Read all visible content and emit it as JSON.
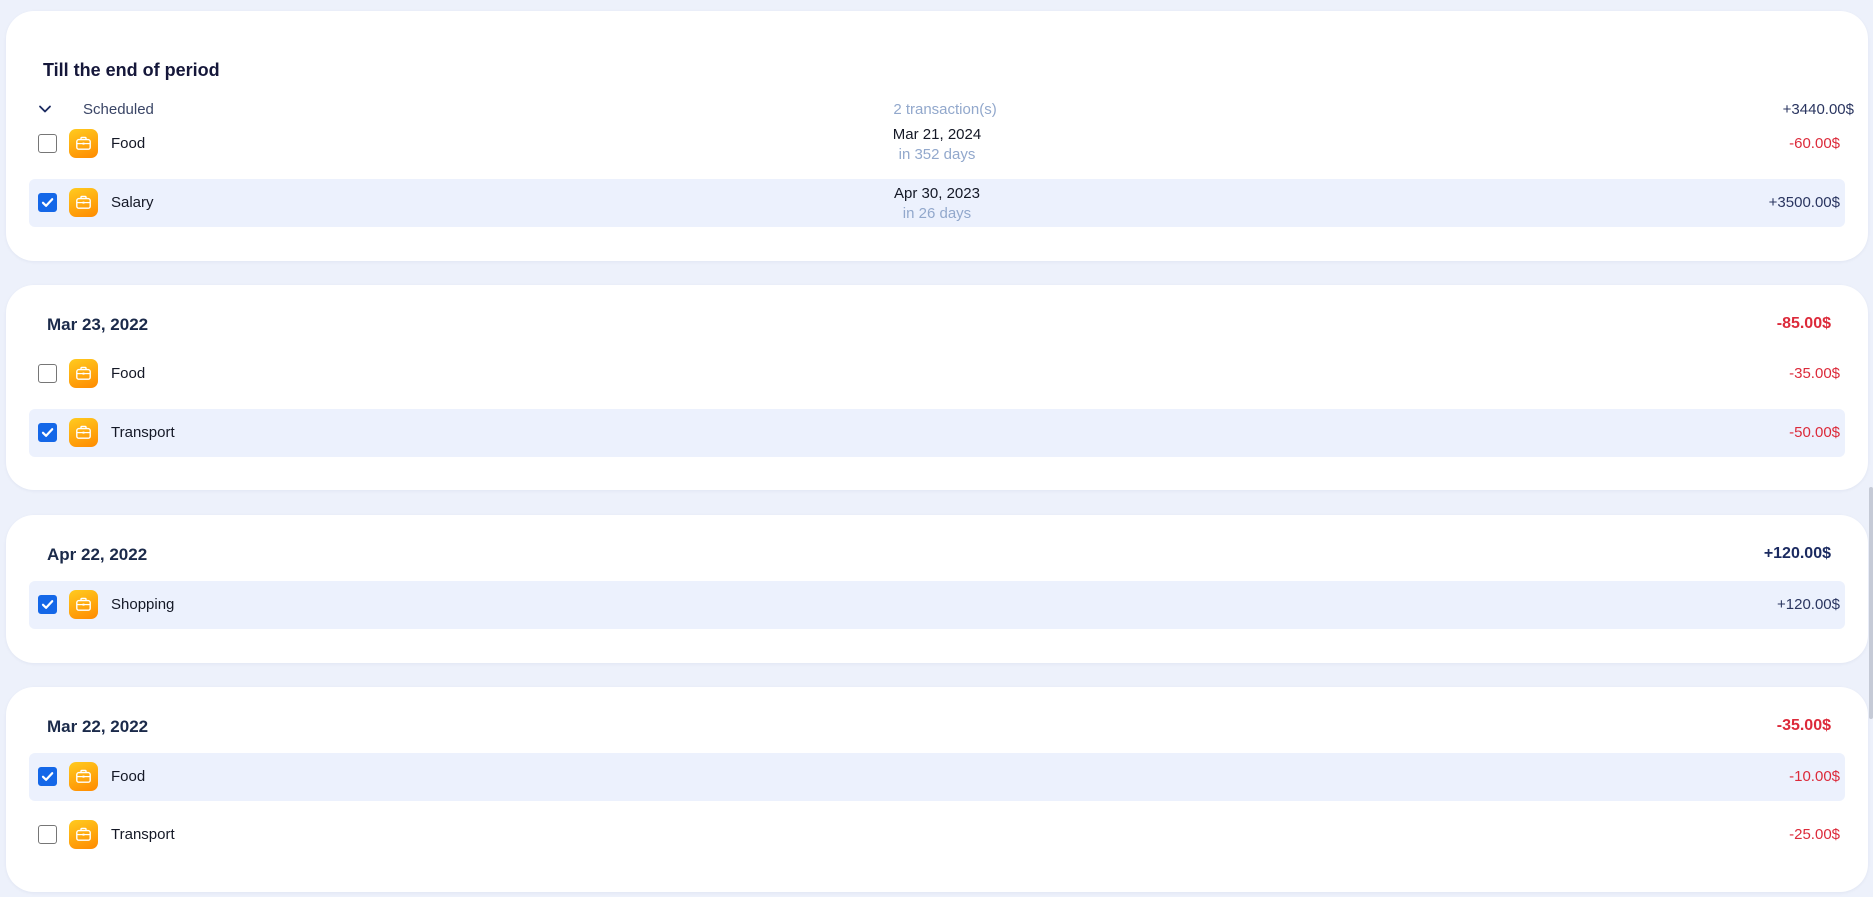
{
  "period": {
    "title": "Till the end of period",
    "scheduled": {
      "label": "Scheduled",
      "count": "2 transaction(s)",
      "total": "+3440.00$",
      "expanded": true
    },
    "items": [
      {
        "name": "Food",
        "date": "Mar 21, 2024",
        "relative": "in 352 days",
        "amount": "-60.00$",
        "checked": false
      },
      {
        "name": "Salary",
        "date": "Apr 30, 2023",
        "relative": "in 26 days",
        "amount": "+3500.00$",
        "checked": true
      }
    ]
  },
  "groups": [
    {
      "date": "Mar 23, 2022",
      "total": "-85.00$",
      "items": [
        {
          "name": "Food",
          "amount": "-35.00$",
          "checked": false
        },
        {
          "name": "Transport",
          "amount": "-50.00$",
          "checked": true
        }
      ]
    },
    {
      "date": "Apr 22, 2022",
      "total": "+120.00$",
      "items": [
        {
          "name": "Shopping",
          "amount": "+120.00$",
          "checked": true
        }
      ]
    },
    {
      "date": "Mar 22, 2022",
      "total": "-35.00$",
      "items": [
        {
          "name": "Food",
          "amount": "-10.00$",
          "checked": true
        },
        {
          "name": "Transport",
          "amount": "-25.00$",
          "checked": false
        }
      ]
    }
  ],
  "icons": {
    "category": "briefcase-icon",
    "collapse": "chevron-down-icon",
    "check": "checkmark-icon"
  },
  "colors": {
    "background": "#edf1fb",
    "card": "#ffffff",
    "selected_row": "#ecf1fd",
    "negative": "#dc2a3a",
    "positive": "#2a3560",
    "muted": "#92a8cc",
    "checkbox_checked": "#1467e8",
    "icon_gradient_start": "#ffcb1f",
    "icon_gradient_end": "#ff8a00"
  }
}
